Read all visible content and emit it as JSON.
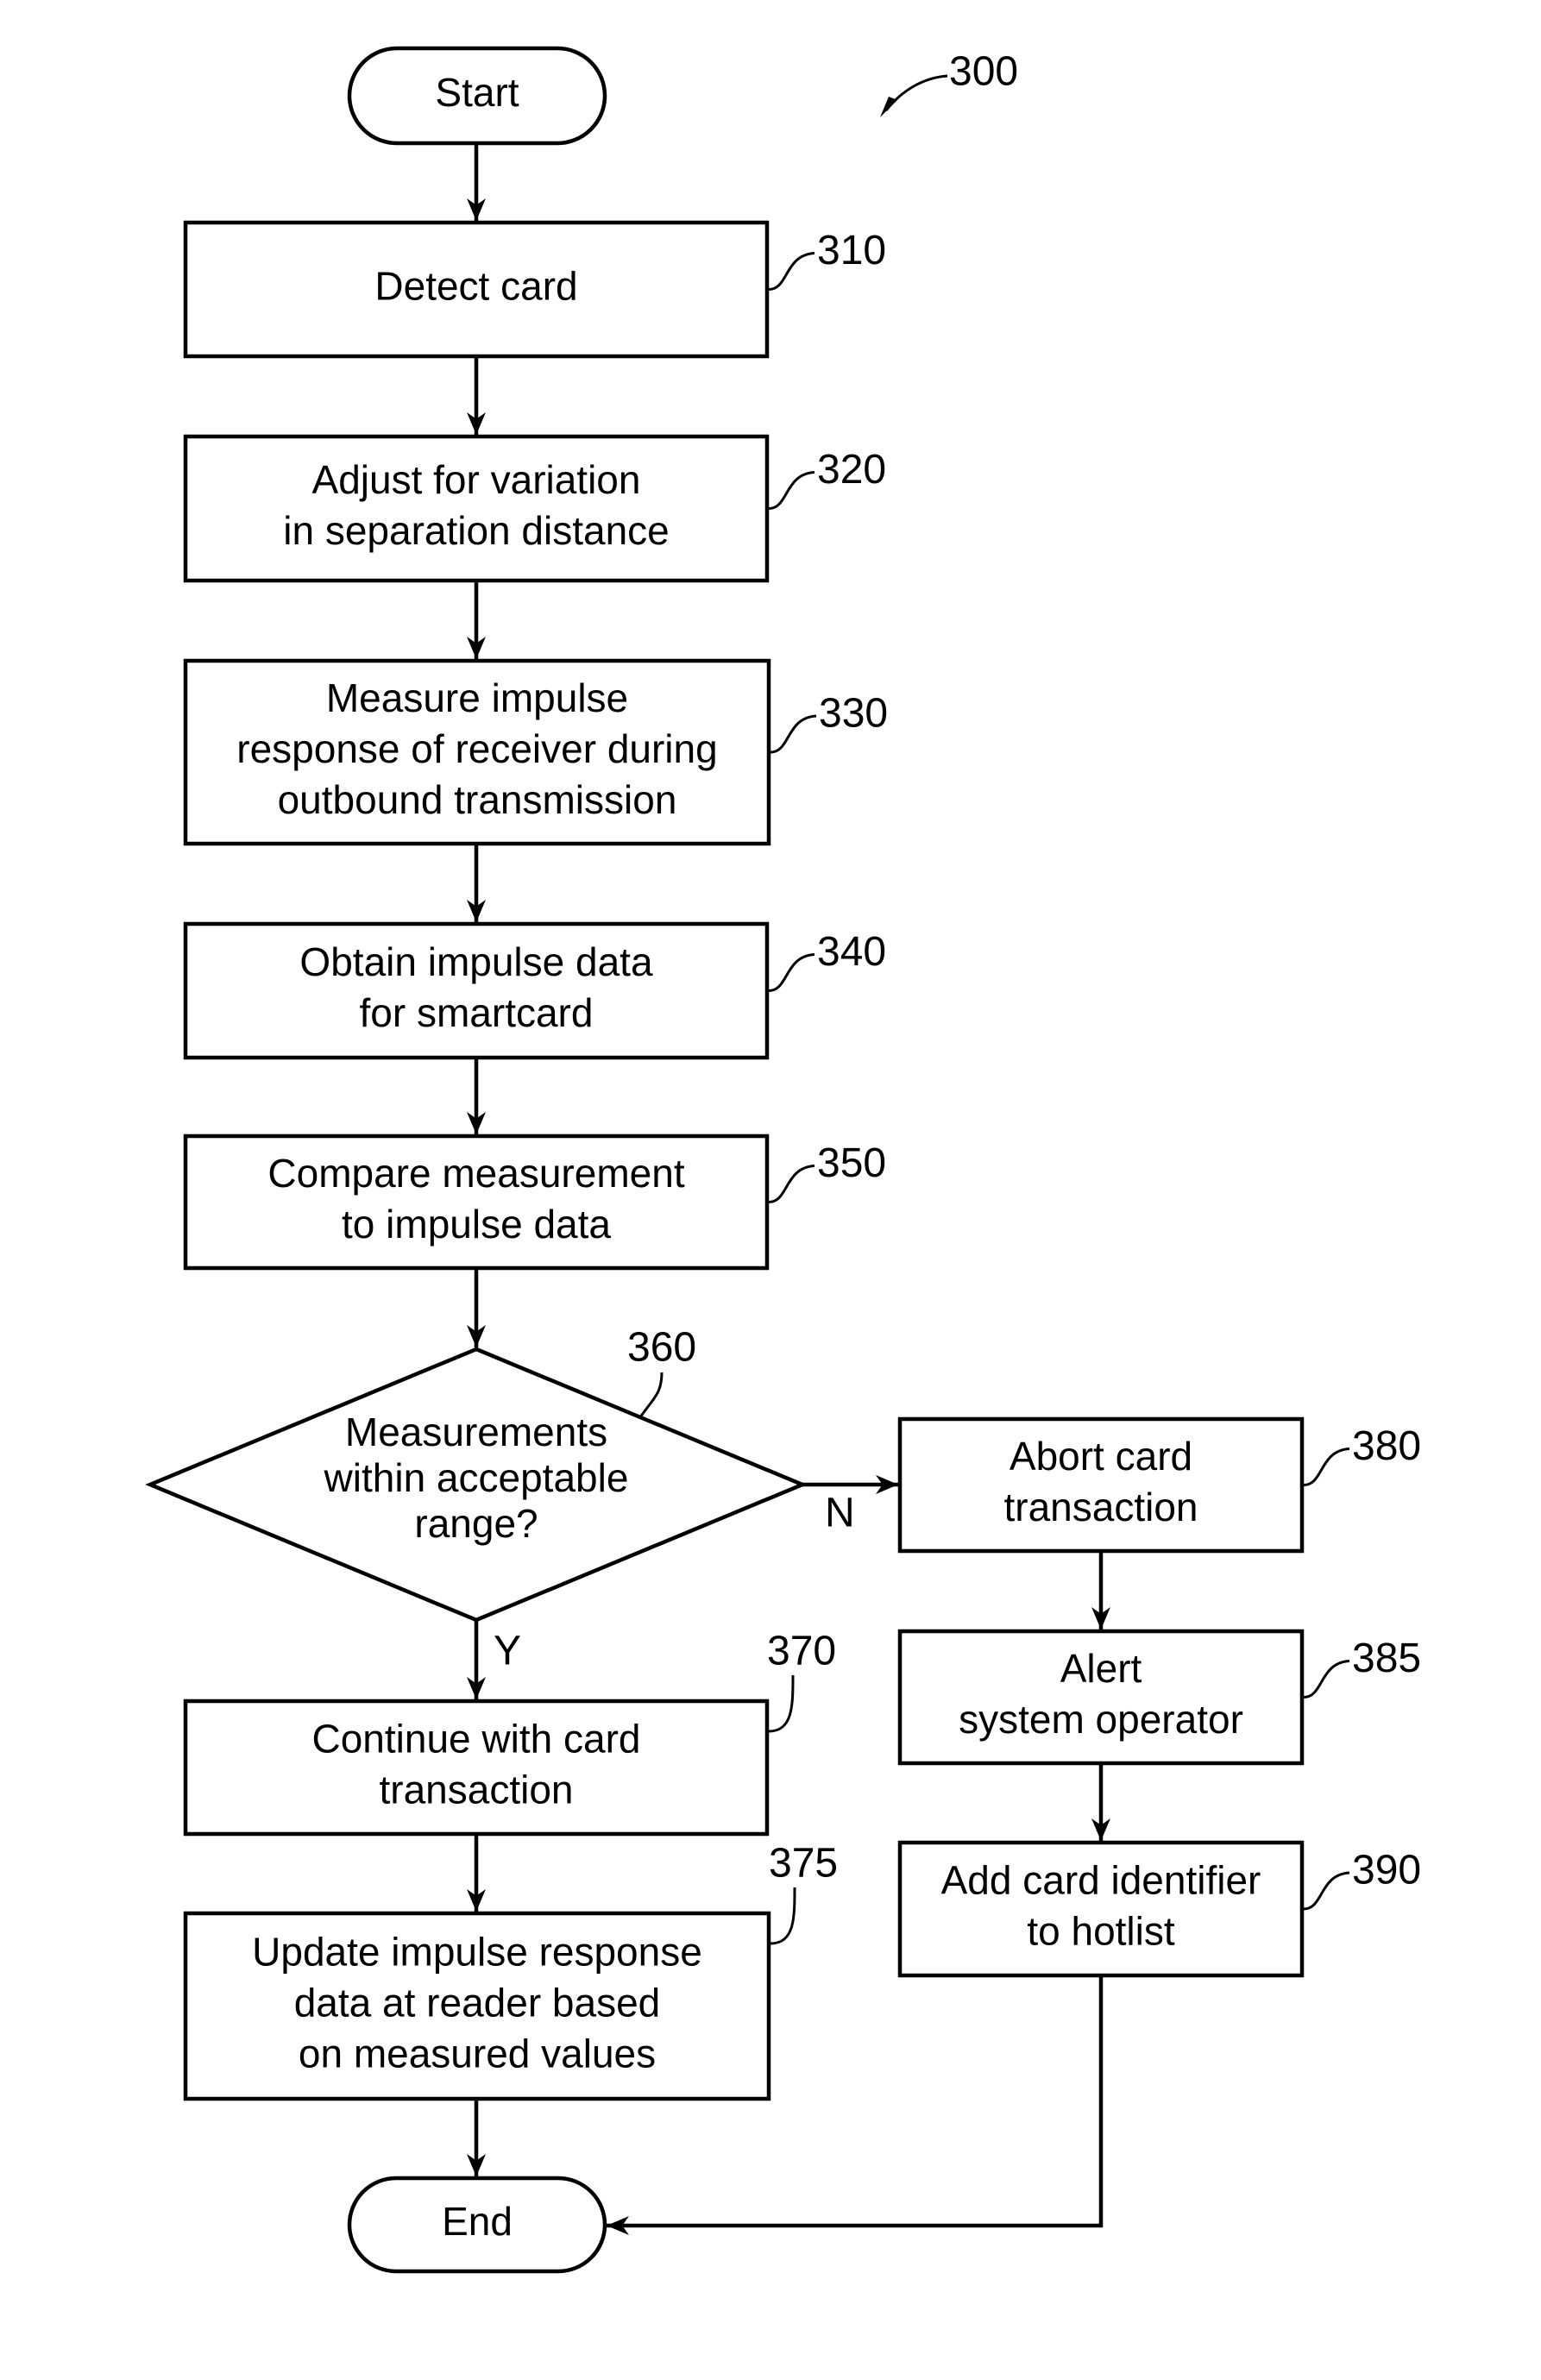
{
  "figure": {
    "reference": "300",
    "start_label": "Start",
    "end_label": "End",
    "steps": [
      {
        "id": "310",
        "lines": [
          "Detect card"
        ]
      },
      {
        "id": "320",
        "lines": [
          "Adjust for variation",
          "in separation distance"
        ]
      },
      {
        "id": "330",
        "lines": [
          "Measure impulse",
          "response of receiver during",
          "outbound transmission"
        ]
      },
      {
        "id": "340",
        "lines": [
          "Obtain impulse data",
          "for smartcard"
        ]
      },
      {
        "id": "350",
        "lines": [
          "Compare measurement",
          "to impulse data"
        ]
      },
      {
        "id": "360",
        "lines": [
          "Measurements",
          "within acceptable",
          "range?"
        ]
      },
      {
        "id": "370",
        "lines": [
          "Continue with card",
          "transaction"
        ]
      },
      {
        "id": "375",
        "lines": [
          "Update impulse response",
          "data at reader based",
          "on measured values"
        ]
      },
      {
        "id": "380",
        "lines": [
          "Abort card",
          "transaction"
        ]
      },
      {
        "id": "385",
        "lines": [
          "Alert",
          "system operator"
        ]
      },
      {
        "id": "390",
        "lines": [
          "Add card identifier",
          "to hotlist"
        ]
      }
    ],
    "decision_yes_label": "Y",
    "decision_no_label": "N"
  }
}
